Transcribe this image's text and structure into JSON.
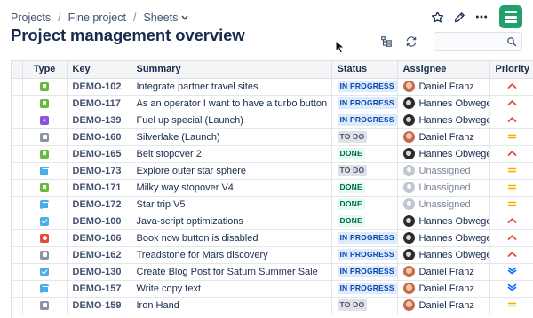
{
  "breadcrumb": {
    "items": [
      "Projects",
      "Fine project",
      "Sheets"
    ],
    "separator": "/"
  },
  "page": {
    "title": "Project management overview"
  },
  "header_actions": [
    {
      "name": "star",
      "icon": "star-icon"
    },
    {
      "name": "edit",
      "icon": "pencil-icon"
    },
    {
      "name": "more",
      "icon": "more-horizontal-icon"
    }
  ],
  "app_logo": {
    "icon": "sheets-app-icon",
    "color": "#22a06b"
  },
  "toolbar": {
    "icons": [
      "hierarchy-icon",
      "refresh-icon"
    ],
    "search_placeholder": "",
    "search_icon": "search-icon"
  },
  "table": {
    "columns": [
      "Type",
      "Key",
      "Summary",
      "Status",
      "Assignee",
      "Priority"
    ],
    "rows": [
      {
        "type": "story",
        "key": "DEMO-102",
        "summary": "Integrate partner travel sites",
        "status": "IN PROGRESS",
        "status_kind": "inprogress",
        "assignee": "Daniel Franz",
        "avatar": "daniel",
        "priority": "high"
      },
      {
        "type": "story",
        "key": "DEMO-117",
        "summary": "As an operator I want to have a turbo button",
        "status": "IN PROGRESS",
        "status_kind": "inprogress",
        "assignee": "Hannes Obweger",
        "avatar": "hannes",
        "priority": "high"
      },
      {
        "type": "epic",
        "key": "DEMO-139",
        "summary": "Fuel up special (Launch)",
        "status": "IN PROGRESS",
        "status_kind": "inprogress",
        "assignee": "Hannes Obweger",
        "avatar": "hannes",
        "priority": "high"
      },
      {
        "type": "subtask",
        "key": "DEMO-160",
        "summary": "Silverlake (Launch)",
        "status": "TO DO",
        "status_kind": "todo",
        "assignee": "Daniel Franz",
        "avatar": "daniel",
        "priority": "medium"
      },
      {
        "type": "story",
        "key": "DEMO-165",
        "summary": "Belt stopover 2",
        "status": "DONE",
        "status_kind": "done",
        "assignee": "Hannes Obweger",
        "avatar": "hannes",
        "priority": "high"
      },
      {
        "type": "improvement",
        "key": "DEMO-173",
        "summary": "Explore outer star sphere",
        "status": "TO DO",
        "status_kind": "todo",
        "assignee": "Unassigned",
        "avatar": "unassigned",
        "priority": "medium"
      },
      {
        "type": "story",
        "key": "DEMO-171",
        "summary": "Milky way stopover V4",
        "status": "DONE",
        "status_kind": "done",
        "assignee": "Unassigned",
        "avatar": "unassigned",
        "priority": "medium"
      },
      {
        "type": "improvement",
        "key": "DEMO-172",
        "summary": "Star trip V5",
        "status": "DONE",
        "status_kind": "done",
        "assignee": "Unassigned",
        "avatar": "unassigned",
        "priority": "medium"
      },
      {
        "type": "task",
        "key": "DEMO-100",
        "summary": "Java-script optimizations",
        "status": "DONE",
        "status_kind": "done",
        "assignee": "Hannes Obweger",
        "avatar": "hannes",
        "priority": "high"
      },
      {
        "type": "bug",
        "key": "DEMO-106",
        "summary": "Book now button is disabled",
        "status": "IN PROGRESS",
        "status_kind": "inprogress",
        "assignee": "Hannes Obweger",
        "avatar": "hannes",
        "priority": "high"
      },
      {
        "type": "subtask",
        "key": "DEMO-162",
        "summary": "Treadstone for Mars discovery",
        "status": "IN PROGRESS",
        "status_kind": "inprogress",
        "assignee": "Hannes Obweger",
        "avatar": "hannes",
        "priority": "high"
      },
      {
        "type": "task",
        "key": "DEMO-130",
        "summary": "Create Blog Post for Saturn Summer Sale",
        "status": "IN PROGRESS",
        "status_kind": "inprogress",
        "assignee": "Daniel Franz",
        "avatar": "daniel",
        "priority": "low"
      },
      {
        "type": "improvement",
        "key": "DEMO-157",
        "summary": "Write copy text",
        "status": "IN PROGRESS",
        "status_kind": "inprogress",
        "assignee": "Daniel Franz",
        "avatar": "daniel",
        "priority": "low"
      },
      {
        "type": "subtask",
        "key": "DEMO-159",
        "summary": "Iron Hand",
        "status": "TO DO",
        "status_kind": "todo",
        "assignee": "Daniel Franz",
        "avatar": "daniel",
        "priority": "medium"
      }
    ]
  },
  "colors": {
    "priority_high": "#e5493a",
    "priority_medium": "#ffab00",
    "priority_low": "#0065ff",
    "status_in_progress": "#0747a6",
    "status_done": "#006644",
    "status_todo": "#42526e"
  }
}
